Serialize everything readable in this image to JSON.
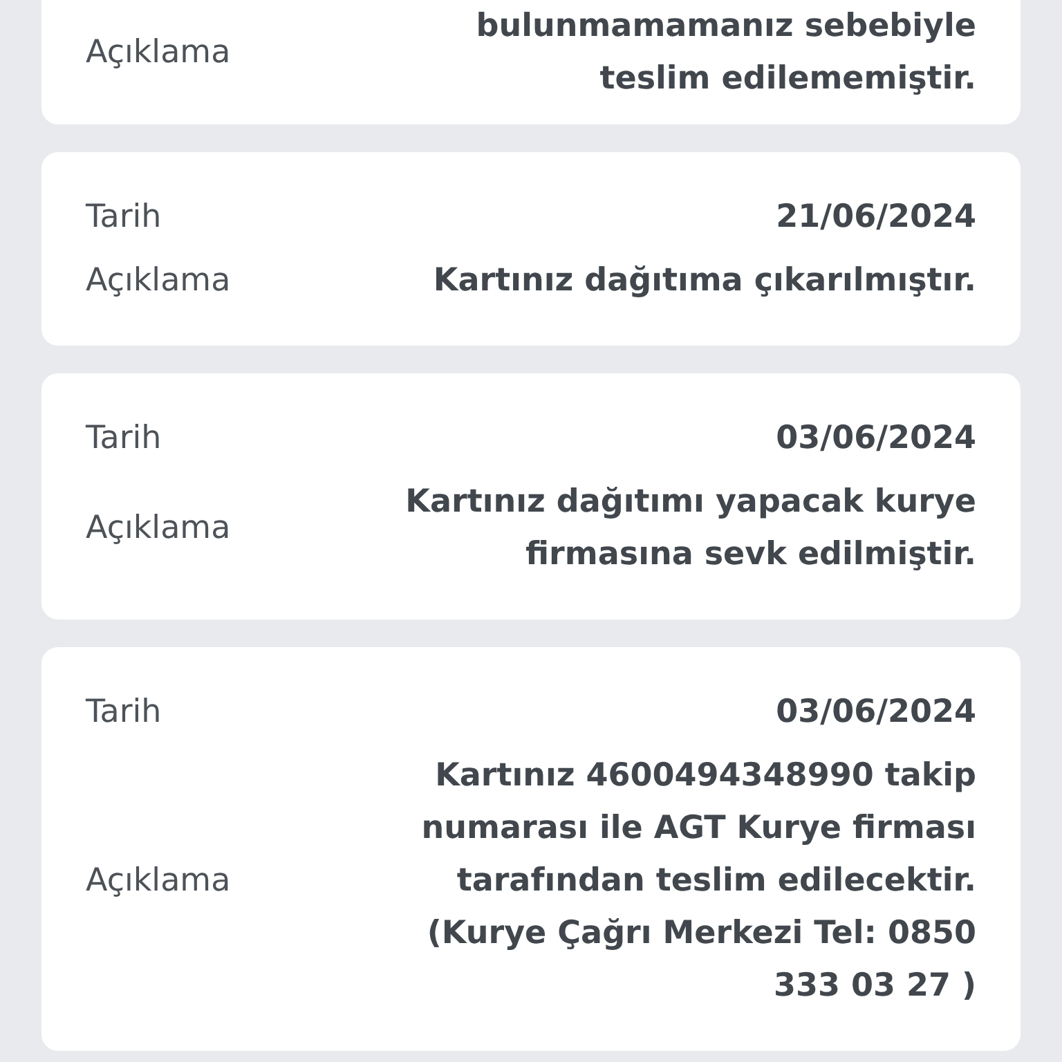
{
  "records": [
    {
      "cut_top": true,
      "rows": [
        {
          "label": "Açıklama",
          "value_lines": [
            "bulunmamamanız sebebiyle",
            "teslim edilememiştir."
          ]
        }
      ]
    },
    {
      "cut_top": false,
      "rows": [
        {
          "label": "Tarih",
          "value_lines": [
            "21/06/2024"
          ]
        },
        {
          "label": "Açıklama",
          "value_lines": [
            "Kartınız dağıtıma çıkarılmıştır."
          ]
        }
      ]
    },
    {
      "cut_top": false,
      "rows": [
        {
          "label": "Tarih",
          "value_lines": [
            "03/06/2024"
          ]
        },
        {
          "label": "Açıklama",
          "value_lines": [
            "Kartınız dağıtımı yapacak kurye",
            "firmasına sevk edilmiştir."
          ]
        }
      ]
    },
    {
      "cut_top": false,
      "rows": [
        {
          "label": "Tarih",
          "value_lines": [
            "03/06/2024"
          ]
        },
        {
          "label": "Açıklama",
          "value_lines": [
            "Kartınız 4600494348990 takip",
            "numarası ile AGT Kurye firması",
            "tarafından teslim edilecektir.",
            "(Kurye Çağrı Merkezi Tel: 0850",
            "333 03 27 )"
          ]
        }
      ]
    }
  ]
}
